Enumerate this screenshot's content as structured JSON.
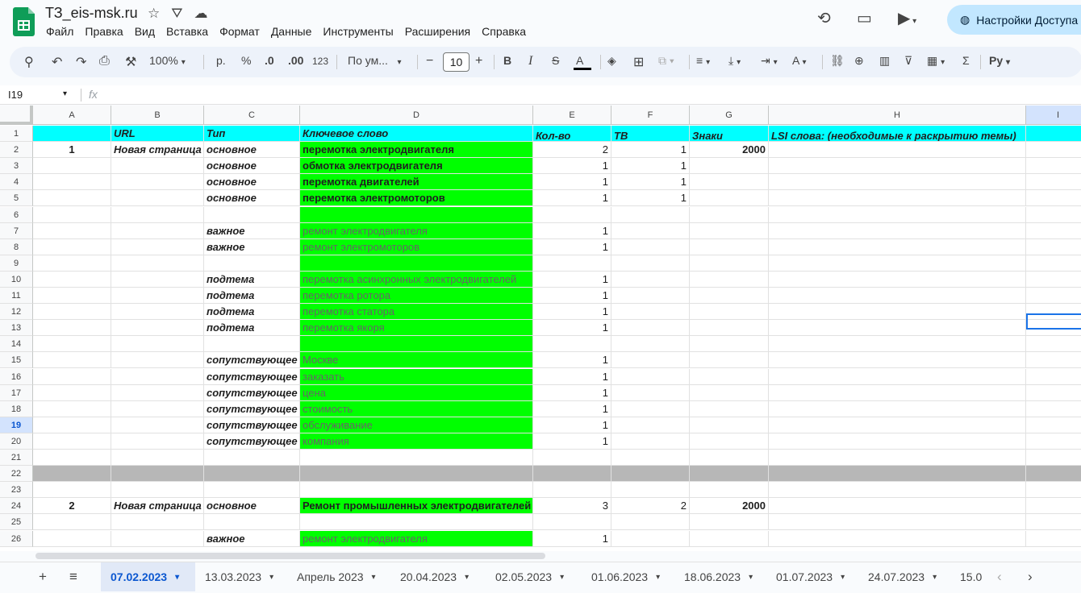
{
  "title": "ТЗ_eis-msk.ru",
  "menu": [
    "Файл",
    "Правка",
    "Вид",
    "Вставка",
    "Формат",
    "Данные",
    "Инструменты",
    "Расширения",
    "Справка"
  ],
  "share_label": "Настройки Доступа",
  "toolbar": {
    "zoom": "100%",
    "currency": "р.",
    "percent": "%",
    "dec_less": ".0",
    "dec_more": ".00",
    "number_format": "123",
    "font": "По ум...",
    "font_size": "10"
  },
  "name_box": "I19",
  "fx_label": "fx",
  "columns": [
    {
      "label": "A"
    },
    {
      "label": "B"
    },
    {
      "label": "C"
    },
    {
      "label": "D"
    },
    {
      "label": "E"
    },
    {
      "label": "F"
    },
    {
      "label": "G"
    },
    {
      "label": "H"
    },
    {
      "label": "I",
      "selected": true
    }
  ],
  "rows": [
    {
      "n": "1",
      "style": "header",
      "A": "",
      "B": "URL",
      "C": "Тип",
      "D": "Ключевое слово",
      "E": "Кол-во",
      "F": "ТВ",
      "G": "Знаки",
      "H": "LSI слова: (необходимые к раскрытию темы)"
    },
    {
      "n": "2",
      "A": "1",
      "B": "Новая страница",
      "C": "основное",
      "D": "перемотка электродвигателя",
      "D_style": "bold",
      "E": "2",
      "F": "1",
      "G": "2000"
    },
    {
      "n": "3",
      "C": "основное",
      "D": "обмотка электродвигателя",
      "D_style": "bold",
      "E": "1",
      "F": "1"
    },
    {
      "n": "4",
      "C": "основное",
      "D": "перемотка двигателей",
      "D_style": "bold",
      "E": "1",
      "F": "1"
    },
    {
      "n": "5",
      "C": "основное",
      "D": "перемотка электромоторов",
      "D_style": "bold",
      "E": "1",
      "F": "1"
    },
    {
      "n": "6",
      "D": ""
    },
    {
      "n": "7",
      "C": "важное",
      "D": "ремонт электродвигателя",
      "D_style": "light",
      "E": "1"
    },
    {
      "n": "8",
      "C": "важное",
      "D": "ремонт электромоторов",
      "D_style": "light",
      "E": "1"
    },
    {
      "n": "9",
      "D": ""
    },
    {
      "n": "10",
      "C": "подтема",
      "D": "перемотка асинхронных электродвигателей",
      "D_style": "light",
      "E": "1"
    },
    {
      "n": "11",
      "C": "подтема",
      "D": "перемотка ротора",
      "D_style": "light",
      "E": "1"
    },
    {
      "n": "12",
      "C": "подтема",
      "D": "перемотка статора",
      "D_style": "light",
      "E": "1"
    },
    {
      "n": "13",
      "C": "подтема",
      "D": "перемотка якоря",
      "D_style": "light",
      "E": "1"
    },
    {
      "n": "14",
      "D": ""
    },
    {
      "n": "15",
      "C": "сопутствующее",
      "D": "Москве",
      "D_style": "light",
      "E": "1"
    },
    {
      "n": "16",
      "C": "сопутствующее",
      "D": "заказать",
      "D_style": "light",
      "E": "1"
    },
    {
      "n": "17",
      "C": "сопутствующее",
      "D": "цена",
      "D_style": "light",
      "E": "1"
    },
    {
      "n": "18",
      "C": "сопутствующее",
      "D": "стоимость",
      "D_style": "light",
      "E": "1"
    },
    {
      "n": "19",
      "selected": true,
      "C": "сопутствующее",
      "D": "обслуживание",
      "D_style": "light",
      "E": "1"
    },
    {
      "n": "20",
      "C": "сопутствующее",
      "D": "компания",
      "D_style": "light",
      "E": "1"
    },
    {
      "n": "21",
      "nogreen": true
    },
    {
      "n": "22",
      "style": "gray",
      "nogreen": true
    },
    {
      "n": "23",
      "nogreen": true
    },
    {
      "n": "24",
      "A": "2",
      "B": "Новая страница",
      "C": "основное",
      "D": "Ремонт промышленных электродвигателей",
      "D_style": "bold",
      "E": "3",
      "F": "2",
      "G": "2000"
    },
    {
      "n": "25",
      "nogreen": true
    },
    {
      "n": "26",
      "C": "важное",
      "D": "ремонт электродвигателя",
      "D_style": "light",
      "E": "1"
    }
  ],
  "sheets": [
    "07.02.2023",
    "13.03.2023",
    "Апрель 2023",
    "20.04.2023",
    "02.05.2023",
    "01.06.2023",
    "18.06.2023",
    "01.07.2023",
    "24.07.2023",
    "15.0"
  ],
  "active_sheet": 0
}
